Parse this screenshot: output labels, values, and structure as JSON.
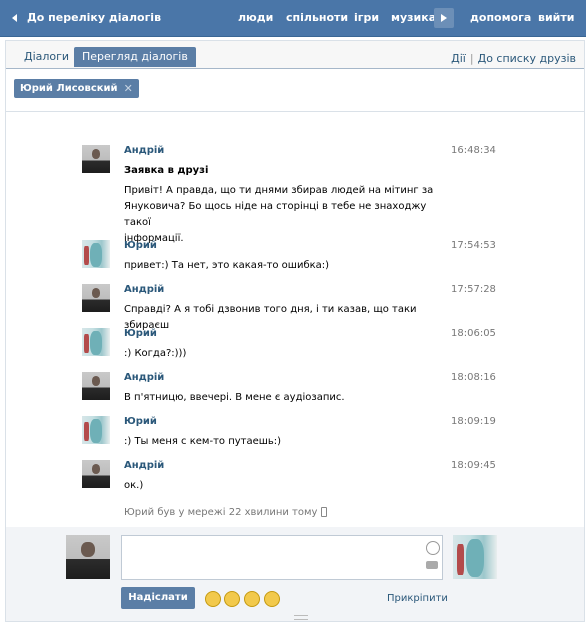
{
  "topbar": {
    "back_label": "До переліку діалогів",
    "nav": [
      "люди",
      "спільноти",
      "ігри",
      "музика",
      "допомога",
      "вийти"
    ]
  },
  "tabs": [
    "Діалоги",
    "Перегляд діалогів"
  ],
  "right_links": [
    "Дії",
    "До списку друзів"
  ],
  "recipient_chip": "Юрий Лисовский",
  "messages": [
    {
      "author": "Андрій",
      "avatar": "andriy-photo",
      "time": "16:48:34",
      "title": "Заявка в друзі",
      "lines": [
        "Привіт! А правда, що ти днями збирав людей на мітинг за",
        "Януковича? Бо щось ніде на сторінці в тебе не знаходжу такої",
        "інформації."
      ]
    },
    {
      "author": "Юрий",
      "avatar": "yuriy-photo",
      "time": "17:54:53",
      "title": "",
      "lines": [
        "привет:) Та нет, это какая-то ошибка:)"
      ]
    },
    {
      "author": "Андрій",
      "avatar": "andriy-photo",
      "time": "17:57:28",
      "title": "",
      "lines": [
        "Справді? А я тобі дзвонив того дня, і ти казав, що таки збираєш"
      ]
    },
    {
      "author": "Юрий",
      "avatar": "yuriy-photo",
      "time": "18:06:05",
      "title": "",
      "lines": [
        ":) Когда?:)))"
      ]
    },
    {
      "author": "Андрій",
      "avatar": "andriy-photo",
      "time": "18:08:16",
      "title": "",
      "lines": [
        "В п'ятницю, ввечері. В мене є аудіозапис."
      ]
    },
    {
      "author": "Юрий",
      "avatar": "yuriy-photo",
      "time": "18:09:19",
      "title": "",
      "lines": [
        ":) Ты меня с кем-то путаешь:)"
      ]
    },
    {
      "author": "Андрій",
      "avatar": "andriy-photo",
      "time": "18:09:45",
      "title": "",
      "lines": [
        "ок.)"
      ]
    }
  ],
  "status_text": "Юрий був у мережі 22 хвилини тому",
  "composer": {
    "input_value": "",
    "send_label": "Надіслати",
    "attach_label": "Прикріпити",
    "emoji_icons": [
      "tongue-face-icon",
      "wink-face-icon",
      "relieved-face-icon",
      "smile-face-icon"
    ]
  }
}
